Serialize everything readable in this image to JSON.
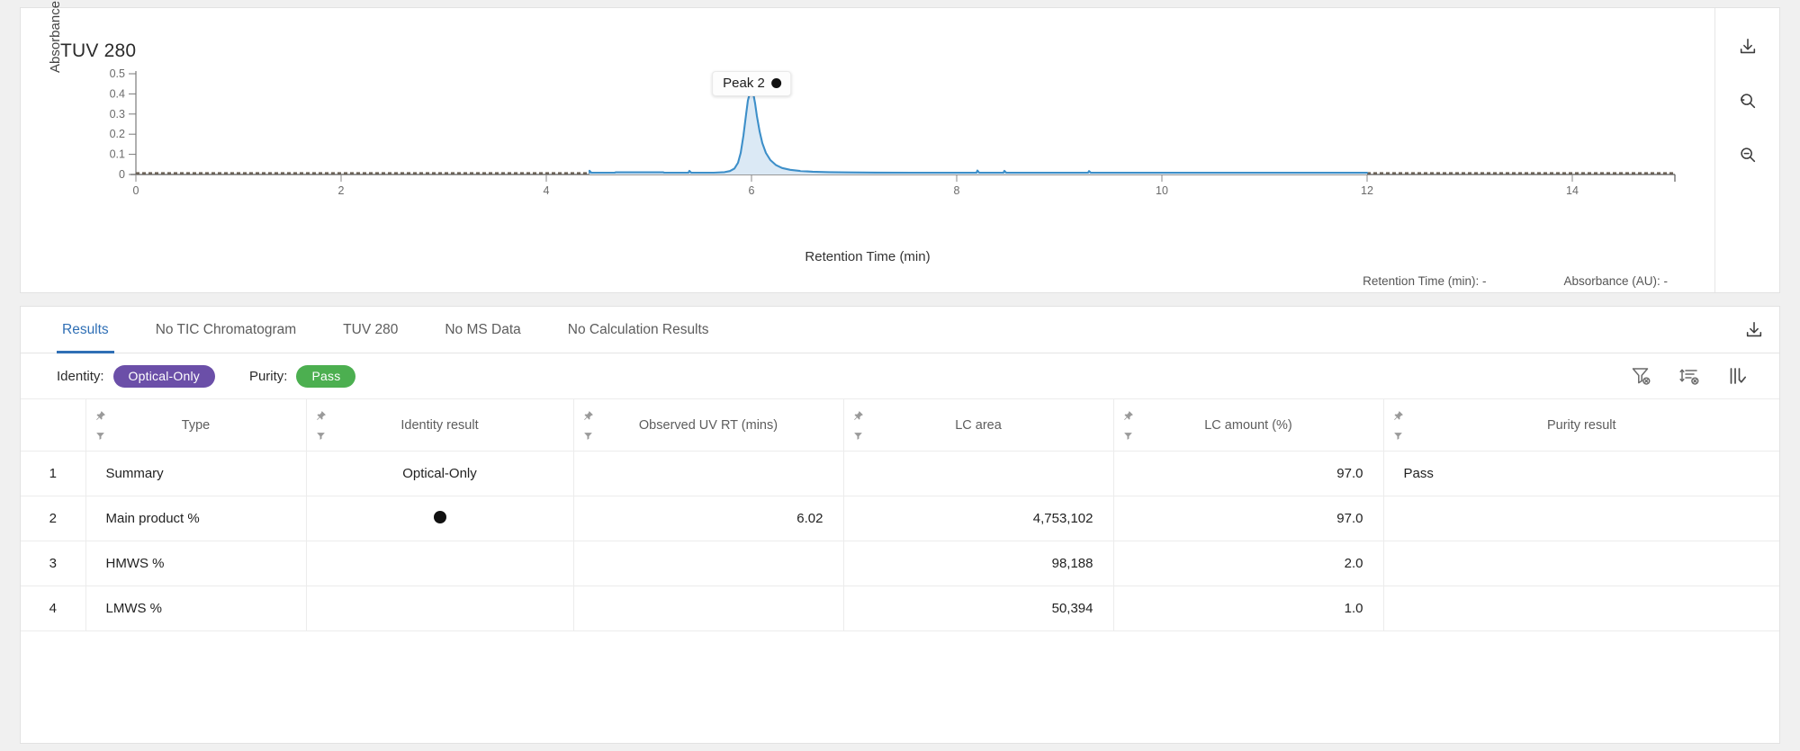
{
  "chromatogram": {
    "title": "TUV 280",
    "y_axis_title": "Absorbance (AU)",
    "x_axis_title": "Retention Time (min)",
    "peak_label": "Peak 2",
    "readout_rt": "Retention Time (min): -",
    "readout_abs": "Absorbance (AU): -",
    "tools": [
      {
        "name": "download-icon",
        "label": "Download"
      },
      {
        "name": "reset-zoom-icon",
        "label": "Reset zoom"
      },
      {
        "name": "zoom-out-icon",
        "label": "Zoom out"
      }
    ]
  },
  "chart_data": {
    "type": "line",
    "title": "TUV 280",
    "xlabel": "Retention Time (min)",
    "ylabel": "Absorbance (AU)",
    "xlim": [
      0,
      15.2
    ],
    "ylim": [
      0,
      0.52
    ],
    "xticks": [
      0,
      2,
      4,
      6,
      8,
      10,
      12,
      14
    ],
    "yticks": [
      0,
      0.1,
      0.2,
      0.3,
      0.4,
      0.5
    ],
    "ytick_labels": [
      "0",
      "0.1",
      "0.2",
      "0.3",
      "0.4",
      "0.5"
    ],
    "grid": false,
    "legend": "none",
    "line_color": "#3d8fc9",
    "fill_color": "#dbe9f5",
    "baseline_color": "#6d6358",
    "annotations": [
      {
        "text": "Peak 2",
        "x": 6.02,
        "y": 0.44,
        "marker": "filled-circle"
      }
    ],
    "series": [
      {
        "name": "TUV 280 trace",
        "x_start": 4.42,
        "x_end": 12.0,
        "main_peak": {
          "center": 6.02,
          "height": 0.44,
          "width": 0.16,
          "tail": 0.38
        },
        "minor_peaks": [
          {
            "center": 4.46,
            "height": 0.028,
            "width": 0.02
          },
          {
            "center": 5.26,
            "height": 0.006,
            "width": 0.06
          },
          {
            "center": 5.62,
            "height": 0.022,
            "width": 0.02
          },
          {
            "center": 7.16,
            "height": 0.026,
            "width": 0.02
          },
          {
            "center": 7.42,
            "height": 0.024,
            "width": 0.02
          },
          {
            "center": 8.24,
            "height": 0.022,
            "width": 0.02
          }
        ],
        "baseline": 0.004
      }
    ]
  },
  "tabs": [
    {
      "label": "Results",
      "active": true
    },
    {
      "label": "No TIC Chromatogram",
      "active": false
    },
    {
      "label": "TUV 280",
      "active": false
    },
    {
      "label": "No MS Data",
      "active": false
    },
    {
      "label": "No Calculation Results",
      "active": false
    }
  ],
  "tabbar_tool": {
    "name": "download-icon",
    "label": "Download results"
  },
  "status": {
    "identity_label": "Identity:",
    "identity_value": "Optical-Only",
    "identity_color": "#6b4fa8",
    "purity_label": "Purity:",
    "purity_value": "Pass",
    "purity_color": "#4caf50"
  },
  "grid_tools": [
    {
      "name": "clear-filters-icon",
      "label": "Clear filters"
    },
    {
      "name": "clear-sort-icon",
      "label": "Clear sorting"
    },
    {
      "name": "column-chooser-icon",
      "label": "Choose columns"
    }
  ],
  "table": {
    "index_header": "",
    "columns": [
      {
        "label": "Type",
        "align": "left"
      },
      {
        "label": "Identity result",
        "align": "left"
      },
      {
        "label": "Observed UV RT (mins)",
        "align": "right"
      },
      {
        "label": "LC area",
        "align": "right"
      },
      {
        "label": "LC amount (%)",
        "align": "right"
      },
      {
        "label": "Purity result",
        "align": "left"
      }
    ],
    "rows": [
      {
        "index": "1",
        "type": "Summary",
        "marker": false,
        "identity_result": "Optical-Only",
        "observed_uv_rt": "",
        "lc_area": "",
        "lc_amount": "97.0",
        "purity_result": "Pass"
      },
      {
        "index": "2",
        "type": "Main product %",
        "marker": true,
        "identity_result": "",
        "observed_uv_rt": "6.02",
        "lc_area": "4,753,102",
        "lc_amount": "97.0",
        "purity_result": ""
      },
      {
        "index": "3",
        "type": "HMWS %",
        "marker": false,
        "identity_result": "",
        "observed_uv_rt": "",
        "lc_area": "98,188",
        "lc_amount": "2.0",
        "purity_result": ""
      },
      {
        "index": "4",
        "type": "LMWS %",
        "marker": false,
        "identity_result": "",
        "observed_uv_rt": "",
        "lc_area": "50,394",
        "lc_amount": "1.0",
        "purity_result": ""
      }
    ]
  }
}
